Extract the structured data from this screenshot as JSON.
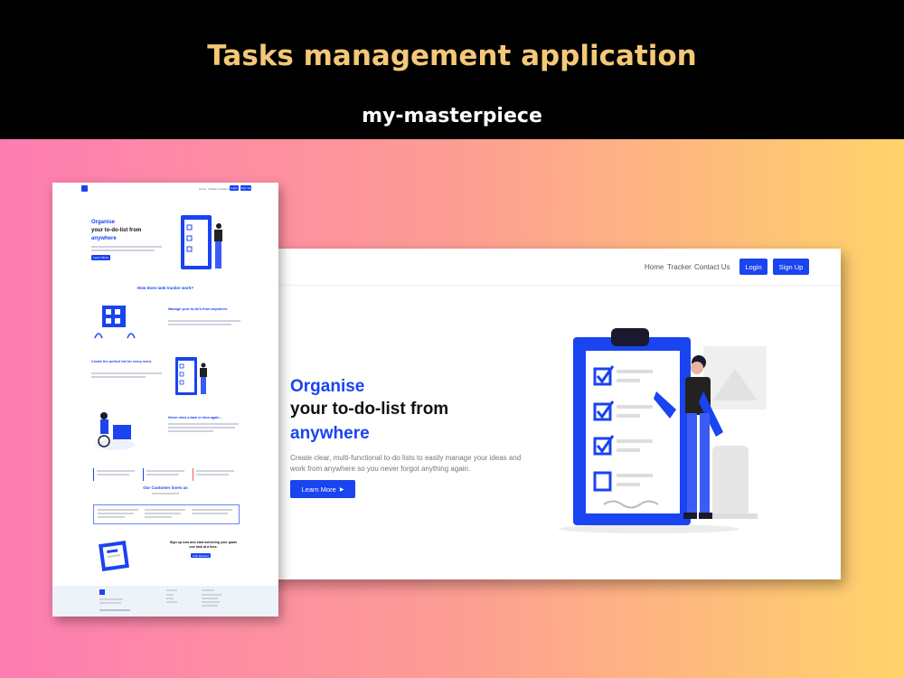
{
  "banner": {
    "title": "Tasks management application",
    "subtitle": "my-masterpiece"
  },
  "desktop": {
    "nav": {
      "links": [
        "Home",
        "Tracker",
        "Contact Us"
      ],
      "login": "Login",
      "signup": "Sign Up"
    },
    "hero": {
      "line1": "Organise",
      "line2": "your to-do-list from",
      "line3": "anywhere",
      "description": "Create clear, multi-functional to-do lists to easily manage your ideas and work from anywhere so you never forgot anything again.",
      "cta": "Learn More"
    }
  },
  "fullpage": {
    "nav": {
      "links": [
        "Home",
        "Tracker",
        "Contact Us"
      ],
      "login": "Login",
      "signup": "Sign Up"
    },
    "hero": {
      "line1": "Organise",
      "line2": "your to-do-list from",
      "line3": "anywhere",
      "cta": "Learn More"
    },
    "how_heading": "How does task tracker work?",
    "features": [
      "Manage your to-do's from anywhere.",
      "Create the perfect list for every need.",
      "Never miss a task or idea again..."
    ],
    "testimonials_heading": "Our Customer loves us",
    "signup_heading": "Sign up now and start achieving your goals one task at a time.",
    "signup_cta": "Get Started"
  },
  "colors": {
    "accent": "#1a44f0",
    "title_gold": "#f5c877",
    "gradient_left": "#fd7db2",
    "gradient_right": "#ffd36a"
  }
}
